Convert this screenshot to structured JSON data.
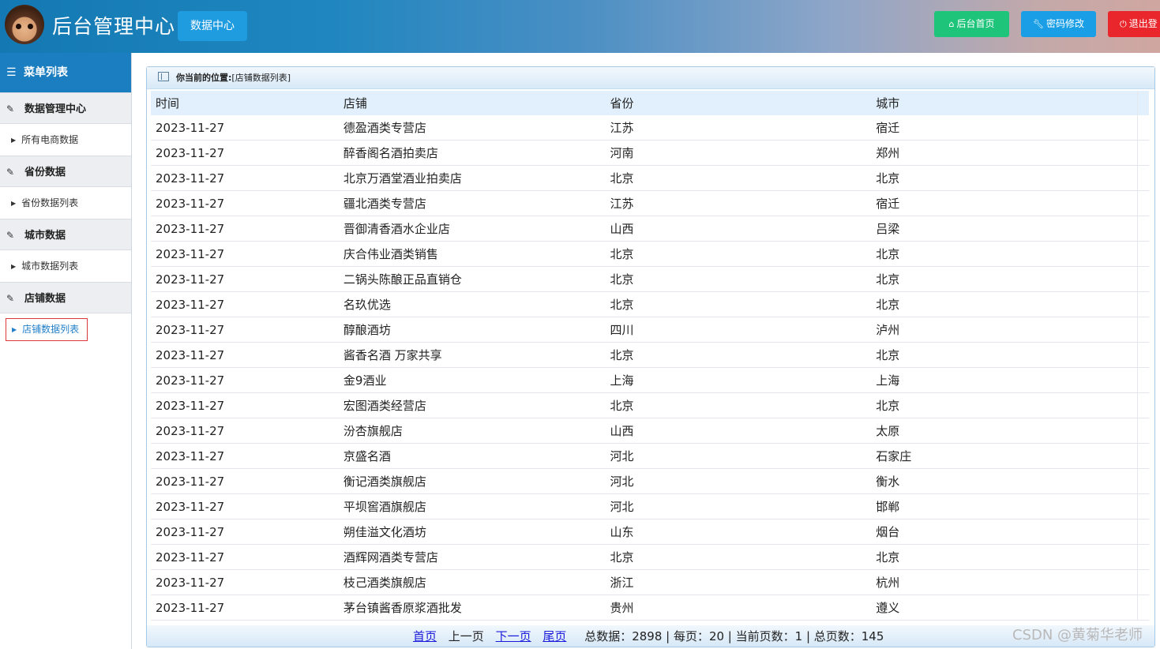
{
  "header": {
    "title": "后台管理中心",
    "nav_button": "数据中心",
    "home_button": "后台首页",
    "password_button": "密码修改",
    "logout_button": "退出登"
  },
  "sidebar": {
    "menu_title": "菜单列表",
    "sections": [
      {
        "label": "数据管理中心",
        "sub": "所有电商数据"
      },
      {
        "label": "省份数据",
        "sub": "省份数据列表"
      },
      {
        "label": "城市数据",
        "sub": "城市数据列表"
      },
      {
        "label": "店铺数据",
        "sub": "店铺数据列表"
      }
    ]
  },
  "breadcrumb": {
    "label": "你当前的位置:",
    "value": "[店铺数据列表]"
  },
  "table": {
    "headers": [
      "时间",
      "店铺",
      "省份",
      "城市"
    ],
    "rows": [
      [
        "2023-11-27",
        "德盈酒类专营店",
        "江苏",
        "宿迁"
      ],
      [
        "2023-11-27",
        "醉香阁名酒拍卖店",
        "河南",
        "郑州"
      ],
      [
        "2023-11-27",
        "北京万酒堂酒业拍卖店",
        "北京",
        "北京"
      ],
      [
        "2023-11-27",
        "疆北酒类专营店",
        "江苏",
        "宿迁"
      ],
      [
        "2023-11-27",
        "晋御清香酒水企业店",
        "山西",
        "吕梁"
      ],
      [
        "2023-11-27",
        "庆合伟业酒类销售",
        "北京",
        "北京"
      ],
      [
        "2023-11-27",
        "二锅头陈酿正品直销仓",
        "北京",
        "北京"
      ],
      [
        "2023-11-27",
        "名玖优选",
        "北京",
        "北京"
      ],
      [
        "2023-11-27",
        "醇酿酒坊",
        "四川",
        "泸州"
      ],
      [
        "2023-11-27",
        "酱香名酒 万家共享",
        "北京",
        "北京"
      ],
      [
        "2023-11-27",
        "金9酒业",
        "上海",
        "上海"
      ],
      [
        "2023-11-27",
        "宏图酒类经营店",
        "北京",
        "北京"
      ],
      [
        "2023-11-27",
        "汾杏旗舰店",
        "山西",
        "太原"
      ],
      [
        "2023-11-27",
        "京盛名酒",
        "河北",
        "石家庄"
      ],
      [
        "2023-11-27",
        "衡记酒类旗舰店",
        "河北",
        "衡水"
      ],
      [
        "2023-11-27",
        "平坝窖酒旗舰店",
        "河北",
        "邯郸"
      ],
      [
        "2023-11-27",
        "朔佳溢文化酒坊",
        "山东",
        "烟台"
      ],
      [
        "2023-11-27",
        "酒辉网酒类专营店",
        "北京",
        "北京"
      ],
      [
        "2023-11-27",
        "枝己酒类旗舰店",
        "浙江",
        "杭州"
      ],
      [
        "2023-11-27",
        "茅台镇酱香原浆酒批发",
        "贵州",
        "遵义"
      ]
    ]
  },
  "pager": {
    "first": "首页",
    "prev": "上一页",
    "next": "下一页",
    "last": "尾页",
    "stats": "总数据：2898 | 每页：20 | 当前页数：1 | 总页数：145"
  },
  "watermark": "CSDN @黄菊华老师",
  "colors": {
    "home_button": "#1ec47a",
    "password_button": "#1a9fe6",
    "logout_button": "#e9262c",
    "active_menu": "#1f7fc8"
  }
}
